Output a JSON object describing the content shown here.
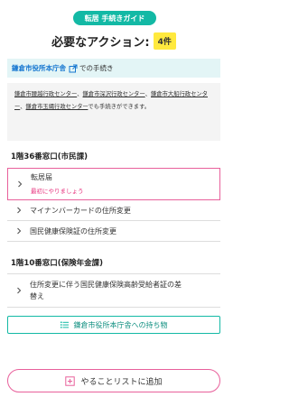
{
  "badge": "転居 手続きガイド",
  "title": "必要なアクション:",
  "count": "4件",
  "office": {
    "link": "鎌倉市役所本庁舎",
    "suffix": "での手続き"
  },
  "note": {
    "links": [
      "鎌倉市腰越行政センター",
      "鎌倉市深沢行政センター",
      "鎌倉市大船行政センター",
      "鎌倉市玉縄行政センター"
    ],
    "sep": "、",
    "tail": "でも手続きができます。"
  },
  "section1": {
    "title": "1階36番窓口(市民課)",
    "items": [
      {
        "label": "転居届",
        "sub": "最初にやりましょう"
      },
      {
        "label": "マイナンバーカードの住所変更"
      },
      {
        "label": "国民健康保険証の住所変更"
      }
    ]
  },
  "section2": {
    "title": "1階10番窓口(保険年金課)",
    "items": [
      {
        "label_line1": "住所変更に伴う国民健康保険高齢受給者証の差",
        "label_line2": "替え"
      }
    ]
  },
  "carry_button": "鎌倉市役所本庁舎への持ち物",
  "todo_button": "やることリストに追加",
  "colors": {
    "teal": "#13b9a5",
    "pink": "#e8609b",
    "yellow": "#ffe93e",
    "link": "#1576d0"
  },
  "icons": [
    "external-link-icon",
    "chevron-right-icon",
    "list-icon",
    "plus-square-icon"
  ]
}
